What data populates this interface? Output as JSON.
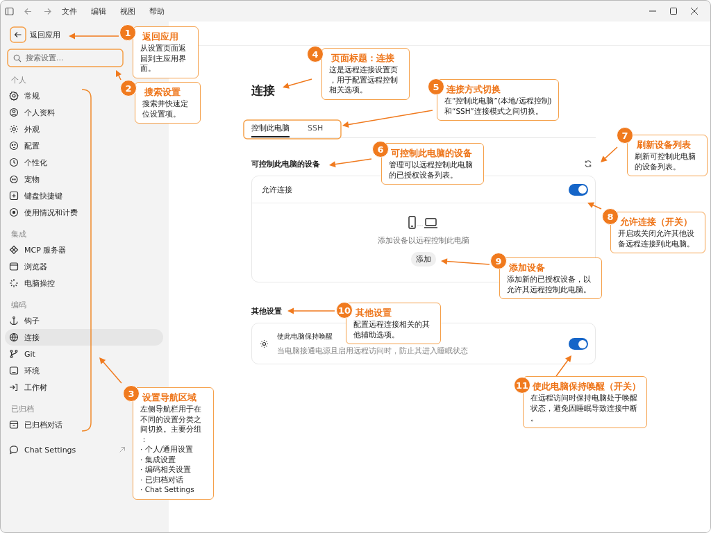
{
  "window": {
    "menu": [
      "文件",
      "编辑",
      "视图",
      "帮助"
    ]
  },
  "sidebar": {
    "back": "返回应用",
    "search": {
      "placeholder": "搜索设置..."
    },
    "groups": [
      {
        "title": "个人",
        "items": [
          {
            "label": "常规",
            "selected": false
          },
          {
            "label": "个人资料",
            "selected": false
          },
          {
            "label": "外观",
            "selected": false
          },
          {
            "label": "配置",
            "selected": false
          },
          {
            "label": "个性化",
            "selected": false
          },
          {
            "label": "宠物",
            "selected": false
          },
          {
            "label": "键盘快捷键",
            "selected": false
          },
          {
            "label": "使用情况和计费",
            "selected": false
          }
        ]
      },
      {
        "title": "集成",
        "items": [
          {
            "label": "MCP 服务器",
            "selected": false
          },
          {
            "label": "浏览器",
            "selected": false
          },
          {
            "label": "电脑操控",
            "selected": false
          }
        ]
      },
      {
        "title": "编码",
        "items": [
          {
            "label": "钩子",
            "selected": false
          },
          {
            "label": "连接",
            "selected": true
          },
          {
            "label": "Git",
            "selected": false
          },
          {
            "label": "环境",
            "selected": false
          },
          {
            "label": "工作树",
            "selected": false
          }
        ]
      },
      {
        "title": "已归档",
        "items": [
          {
            "label": "已归档对话",
            "selected": false
          }
        ]
      }
    ],
    "footer": {
      "label": "Chat Settings"
    }
  },
  "page": {
    "title": "连接",
    "tabs": [
      {
        "label": "控制此电脑",
        "selected": true
      },
      {
        "label": "SSH",
        "selected": false
      }
    ],
    "devices": {
      "heading": "可控制此电脑的设备",
      "allow": {
        "label": "允许连接",
        "on": true
      },
      "empty": "添加设备以远程控制此电脑",
      "add": "添加"
    },
    "other": {
      "heading": "其他设置",
      "keep_awake": {
        "title": "使此电脑保持唤醒",
        "description": "当电脑接通电源且启用远程访问时，防止其进入睡眠状态",
        "on": true
      }
    }
  },
  "annotations": [
    {
      "number": "1",
      "title": "返回应用",
      "body": "从设置页面返回到主应用界面。"
    },
    {
      "number": "2",
      "title": "搜索设置",
      "body": "搜索并快速定位设置项。"
    },
    {
      "number": "3",
      "title": "设置导航区域",
      "body": "左侧导航栏用于在不同的设置分类之间切换。主要分组：",
      "items": [
        "· 个人/通用设置",
        "· 集成设置",
        "· 编码相关设置",
        "· 已归档对话",
        "· Chat Settings"
      ]
    },
    {
      "number": "4",
      "title": "页面标题：连接",
      "body": "这是远程连接设置页，用于配置远程控制相关选项。"
    },
    {
      "number": "5",
      "title": "连接方式切换",
      "body": "在“控制此电脑”(本地/远程控制)和“SSH”连接模式之间切换。"
    },
    {
      "number": "6",
      "title": "可控制此电脑的设备",
      "body": "管理可以远程控制此电脑的已授权设备列表。"
    },
    {
      "number": "7",
      "title": "刷新设备列表",
      "body": "刷新可控制此电脑的设备列表。"
    },
    {
      "number": "8",
      "title": "允许连接（开关）",
      "body": "开启或关闭允许其他设备远程连接到此电脑。"
    },
    {
      "number": "9",
      "title": "添加设备",
      "body": "添加新的已授权设备，以允许其远程控制此电脑。"
    },
    {
      "number": "10",
      "title": "其他设置",
      "body": "配置远程连接相关的其他辅助选项。"
    },
    {
      "number": "11",
      "title": "使此电脑保持唤醒（开关）",
      "body": "在远程访问时保持电脑处于唤醒状态，避免因睡眠导致连接中断。"
    }
  ]
}
